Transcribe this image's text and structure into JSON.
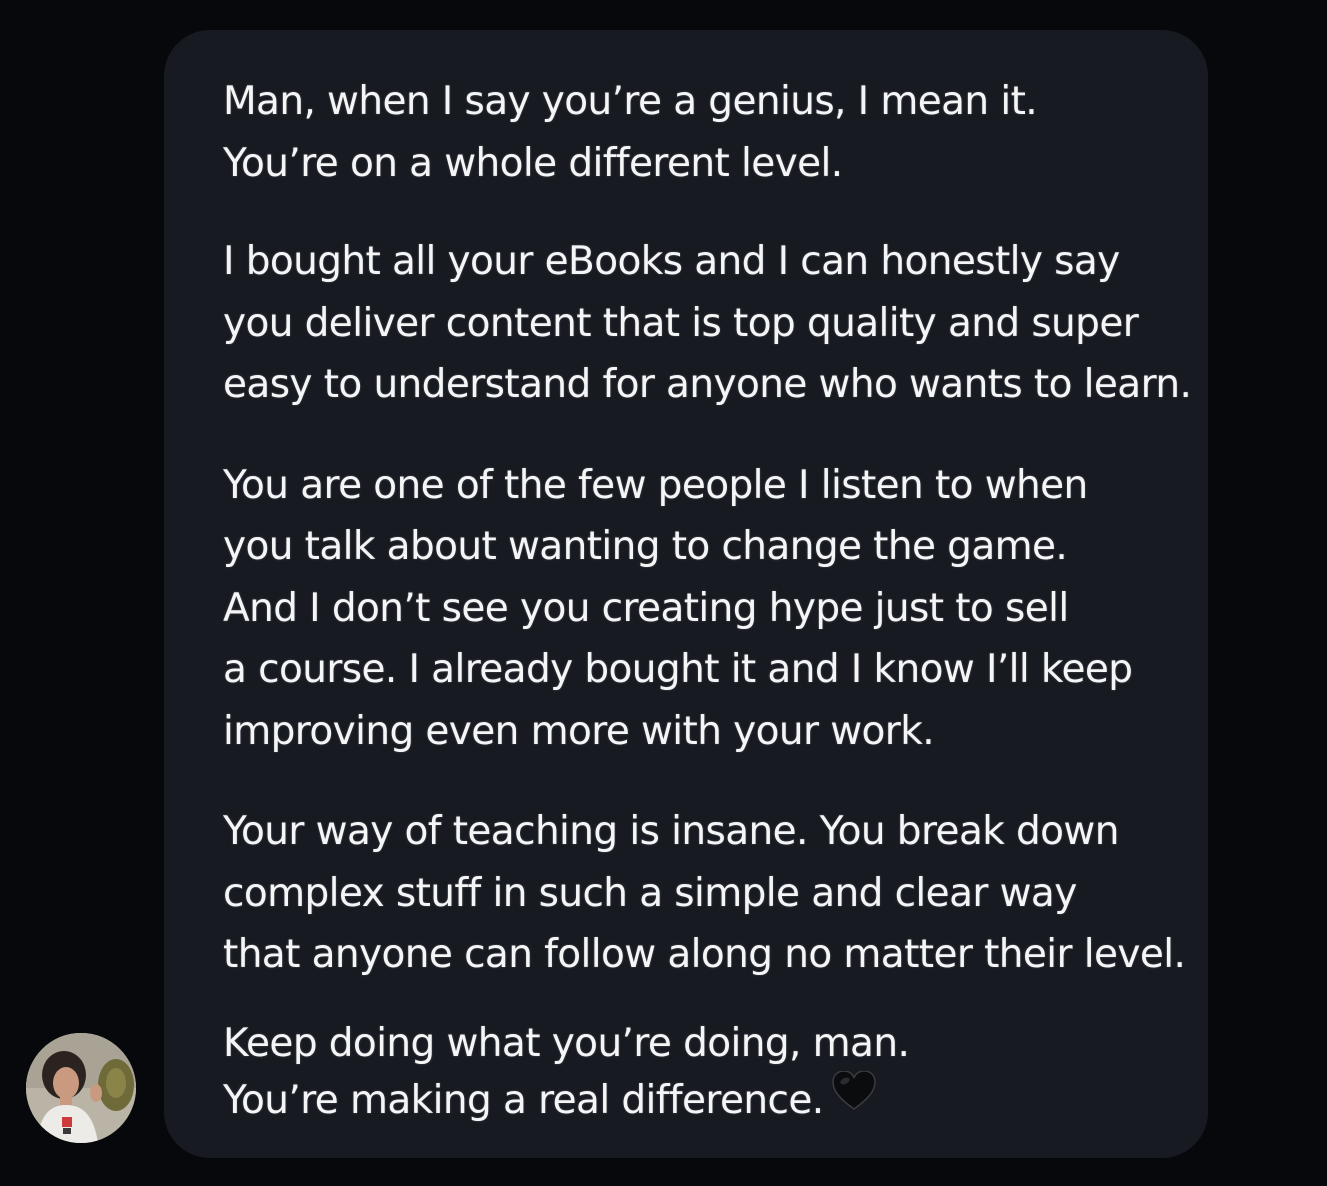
{
  "message": {
    "paragraphs": [
      {
        "lines": [
          "Man, when I say you’re a genius, I mean it.",
          "You’re on a whole different level."
        ]
      },
      {
        "lines": [
          "I bought all your eBooks and I can honestly say",
          "you deliver content that is top quality and super",
          "easy to understand for anyone who wants to learn."
        ]
      },
      {
        "lines": [
          "You are one of the few people I listen to when",
          "you talk about wanting to change the game.",
          "And I don’t see you creating hype just to sell",
          "a course. I already bought it and I know I’ll keep",
          "improving even more with your work."
        ]
      },
      {
        "lines": [
          "Your way of teaching is insane. You break down",
          "complex stuff in such a simple and clear way",
          "that anyone can follow along no matter their level."
        ]
      },
      {
        "lines": [
          "Keep doing what you’re doing, man.",
          "You’re making a real difference."
        ]
      }
    ],
    "emoji": "black-heart-icon"
  },
  "sender": {
    "avatar": "sender-avatar"
  },
  "colors": {
    "background": "#06080c",
    "bubble": "#171a21",
    "text": "#f4f5f7"
  }
}
